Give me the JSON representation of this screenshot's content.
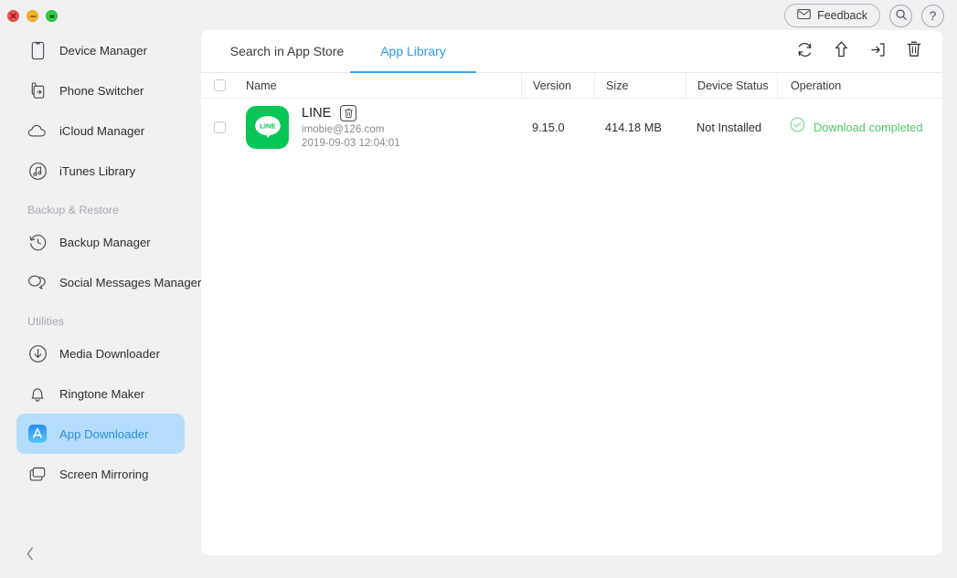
{
  "window": {
    "traffic": [
      {
        "name": "close-button",
        "color": "#f0544c"
      },
      {
        "name": "minimize-button",
        "color": "#f5b32c"
      },
      {
        "name": "maximize-button",
        "color": "#35c94a"
      }
    ]
  },
  "header": {
    "feedback_label": "Feedback",
    "search_icon": "search-icon",
    "help_icon": "help-icon"
  },
  "sidebar": {
    "top_items": [
      {
        "label": "Device Manager",
        "icon": "device-icon",
        "active": false
      },
      {
        "label": "Phone Switcher",
        "icon": "phone-switcher-icon",
        "active": false
      },
      {
        "label": "iCloud Manager",
        "icon": "icloud-icon",
        "active": false
      },
      {
        "label": "iTunes Library",
        "icon": "itunes-icon",
        "active": false
      }
    ],
    "section_backup": "Backup & Restore",
    "backup_items": [
      {
        "label": "Backup Manager",
        "icon": "backup-clock-icon",
        "active": false
      },
      {
        "label": "Social Messages Manager",
        "icon": "chat-bubbles-icon",
        "active": false
      }
    ],
    "section_utilities": "Utilities",
    "utility_items": [
      {
        "label": "Media Downloader",
        "icon": "download-circle-icon",
        "active": false
      },
      {
        "label": "Ringtone Maker",
        "icon": "bell-icon",
        "active": false
      },
      {
        "label": "App Downloader",
        "icon": "app-store-icon",
        "active": true
      },
      {
        "label": "Screen Mirroring",
        "icon": "screens-icon",
        "active": false
      }
    ],
    "collapse_icon": "chevron-left-icon",
    "active_color": "#2e8fe0",
    "active_bg": "#b4ddfb"
  },
  "main": {
    "tabs": [
      {
        "label": "Search in App Store",
        "active": false
      },
      {
        "label": "App Library",
        "active": true
      }
    ],
    "toolbar": [
      {
        "name": "refresh-icon"
      },
      {
        "name": "upload-icon"
      },
      {
        "name": "install-icon"
      },
      {
        "name": "delete-icon"
      }
    ],
    "table": {
      "headers": {
        "name": "Name",
        "version": "Version",
        "size": "Size",
        "device_status": "Device Status",
        "operation": "Operation"
      },
      "rows": [
        {
          "app_name": "LINE",
          "account": "imobie@126.com",
          "date": "2019-09-03 12:04:01",
          "version": "9.15.0",
          "size": "414.18 MB",
          "device_status": "Not Installed",
          "operation": "Download completed",
          "operation_color": "#4ec86e",
          "icon_label": "LINE",
          "icon_color": "#06c755"
        }
      ]
    }
  }
}
